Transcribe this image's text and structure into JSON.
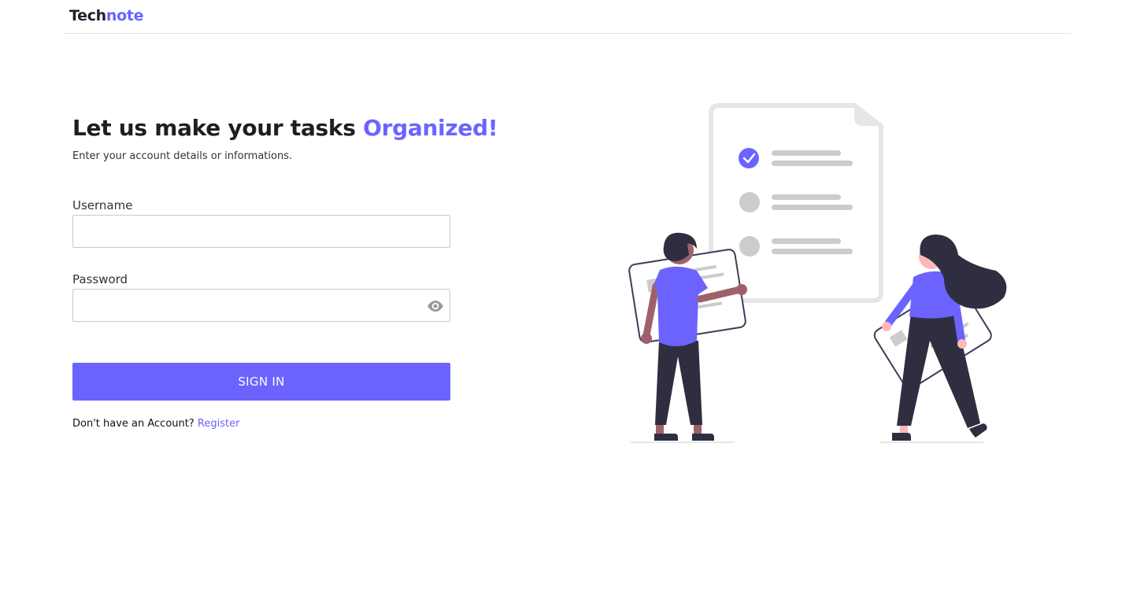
{
  "header": {
    "brand_part1": "Tech",
    "brand_part2": "note"
  },
  "login": {
    "heading": "Let us make your tasks",
    "heading_accent": "Organized!",
    "subtitle": "Enter your account details or informations.",
    "username_label": "Username",
    "username_value": "",
    "password_label": "Password",
    "password_value": "",
    "password_toggle_icon": "eye-icon",
    "submit_label": "SIGN IN",
    "register_prompt": "Don't have an Account?",
    "register_link": "Register"
  },
  "colors": {
    "accent": "#6c63ff",
    "dark": "#2f2e41",
    "border": "#c9c9c9",
    "divider": "#e3e3e3"
  }
}
